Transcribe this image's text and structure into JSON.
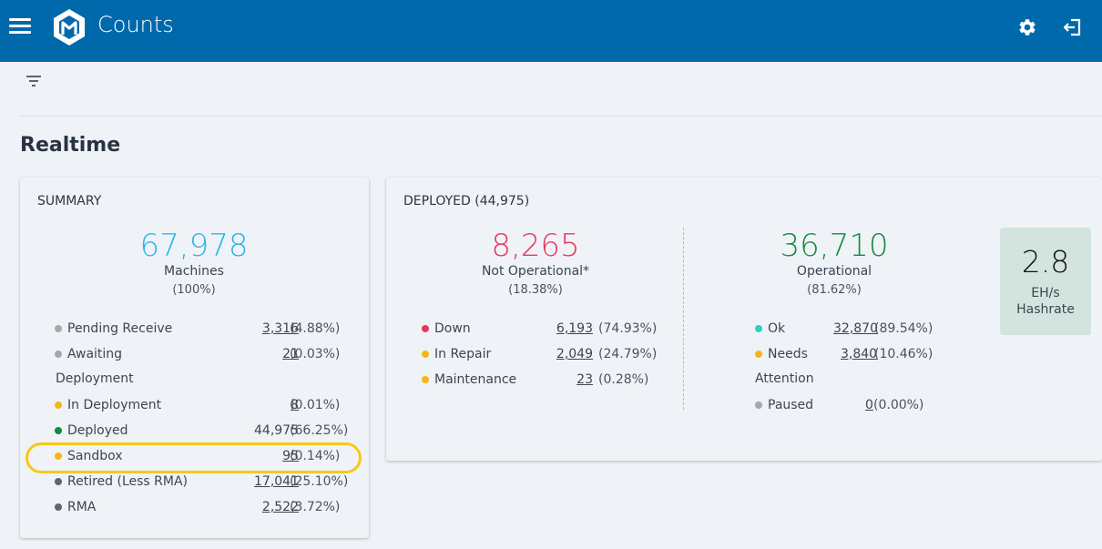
{
  "app": {
    "title": "Counts"
  },
  "section": {
    "title": "Realtime"
  },
  "colors": {
    "header": "#0069ab",
    "blue": "#2bb6e8",
    "red": "#e8385e",
    "green": "#138a3f",
    "yellow": "#f5b716",
    "gray": "#a4a8ad",
    "dark": "#5d6472",
    "teal": "#2dcfc6"
  },
  "summary": {
    "title": "SUMMARY",
    "total": "67,978",
    "total_label": "Machines",
    "total_pct": "(100%)",
    "rows": [
      {
        "label": "Pending Receive",
        "value": "3,316",
        "pct": "(4.88%)",
        "color": "gray"
      },
      {
        "label": "Awaiting",
        "value": "21",
        "pct": "(0.03%)",
        "color": "gray"
      },
      {
        "label": "Deployment"
      },
      {
        "label": "In Deployment",
        "value": "8",
        "pct": "(0.01%)",
        "color": "yellow"
      },
      {
        "label": "Deployed",
        "value": "44,975",
        "pct": "(66.25%)",
        "color": "green"
      },
      {
        "label": "Sandbox",
        "value": "95",
        "pct": "(0.14%)",
        "color": "yellow"
      },
      {
        "label": "Retired (Less RMA)",
        "value": "17,041",
        "pct": "(25.10%)",
        "color": "dark"
      },
      {
        "label": "RMA",
        "value": "2,522",
        "pct": "(3.72%)",
        "color": "dark"
      }
    ]
  },
  "deployed": {
    "title": "DEPLOYED (44,975)",
    "not_operational": {
      "value": "8,265",
      "label": "Not Operational*",
      "pct": "(18.38%)",
      "rows": [
        {
          "label": "Down",
          "value": "6,193",
          "pct": "(74.93%)",
          "color": "red"
        },
        {
          "label": "In Repair",
          "value": "2,049",
          "pct": "(24.79%)",
          "color": "yellow"
        },
        {
          "label": "Maintenance",
          "value": "23",
          "pct": "(0.28%)",
          "color": "yellow"
        }
      ]
    },
    "operational": {
      "value": "36,710",
      "label": "Operational",
      "pct": "(81.62%)",
      "rows": [
        {
          "label": "Ok",
          "value": "32,870",
          "pct": "(89.54%)",
          "color": "teal"
        },
        {
          "label": "Needs",
          "value": "3,840",
          "pct": "(10.46%)",
          "color": "yellow"
        },
        {
          "label": "Attention"
        },
        {
          "label": "Paused",
          "value": "0",
          "pct": "(0.00%)",
          "color": "gray"
        }
      ]
    },
    "hashrate": {
      "value": "2.8",
      "unit": "EH/s",
      "label": "Hashrate"
    }
  }
}
